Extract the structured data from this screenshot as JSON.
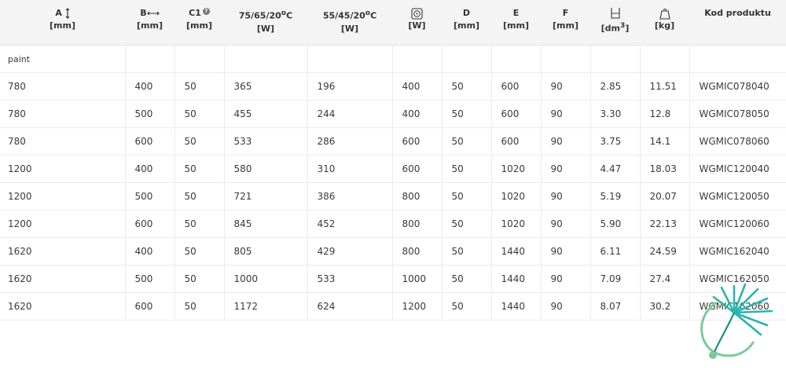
{
  "table": {
    "headers": [
      {
        "label": "A",
        "unit": "[mm]",
        "icon": "height-arrow-icon"
      },
      {
        "label": "B",
        "unit": "[mm]",
        "icon": "width-arrow-icon"
      },
      {
        "label": "C1",
        "unit": "[mm]",
        "icon": "help-icon"
      },
      {
        "label": "75/65/20",
        "sup": "o",
        "suffix": "C",
        "unit": "[W]"
      },
      {
        "label": "55/45/20",
        "sup": "o",
        "suffix": "C",
        "unit": "[W]"
      },
      {
        "label": "",
        "unit": "[W]",
        "icon": "heating-element-icon"
      },
      {
        "label": "D",
        "unit": "[mm]"
      },
      {
        "label": "E",
        "unit": "[mm]"
      },
      {
        "label": "F",
        "unit": "[mm]"
      },
      {
        "label": "",
        "unit": "[dm",
        "unit_sup": "3",
        "unit_suffix": "]",
        "icon": "volume-icon"
      },
      {
        "label": "",
        "unit": "[kg]",
        "icon": "weight-icon"
      },
      {
        "label": "Kod produktu",
        "unit": ""
      }
    ],
    "group_row": "paint",
    "rows": [
      [
        "780",
        "400",
        "50",
        "365",
        "196",
        "400",
        "50",
        "600",
        "90",
        "2.85",
        "11.51",
        "WGMIC078040"
      ],
      [
        "780",
        "500",
        "50",
        "455",
        "244",
        "400",
        "50",
        "600",
        "90",
        "3.30",
        "12.8",
        "WGMIC078050"
      ],
      [
        "780",
        "600",
        "50",
        "533",
        "286",
        "600",
        "50",
        "600",
        "90",
        "3.75",
        "14.1",
        "WGMIC078060"
      ],
      [
        "1200",
        "400",
        "50",
        "580",
        "310",
        "600",
        "50",
        "1020",
        "90",
        "4.47",
        "18.03",
        "WGMIC120040"
      ],
      [
        "1200",
        "500",
        "50",
        "721",
        "386",
        "800",
        "50",
        "1020",
        "90",
        "5.19",
        "20.07",
        "WGMIC120050"
      ],
      [
        "1200",
        "600",
        "50",
        "845",
        "452",
        "800",
        "50",
        "1020",
        "90",
        "5.90",
        "22.13",
        "WGMIC120060"
      ],
      [
        "1620",
        "400",
        "50",
        "805",
        "429",
        "800",
        "50",
        "1440",
        "90",
        "6.11",
        "24.59",
        "WGMIC162040"
      ],
      [
        "1620",
        "500",
        "50",
        "1000",
        "533",
        "1000",
        "50",
        "1440",
        "90",
        "7.09",
        "27.4",
        "WGMIC162050"
      ],
      [
        "1620",
        "600",
        "50",
        "1172",
        "624",
        "1200",
        "50",
        "1440",
        "90",
        "8.07",
        "30.2",
        "WGMIC162060"
      ]
    ]
  },
  "help_badge": "?",
  "logo": {
    "icon": "dandelion-logo-icon",
    "colors": [
      "#29b5ad",
      "#7ec99a",
      "#1f8c8c"
    ]
  },
  "colors": {
    "header_bg": "#f4f4f4",
    "grid": "#ececec",
    "text": "#3a3a3a"
  }
}
